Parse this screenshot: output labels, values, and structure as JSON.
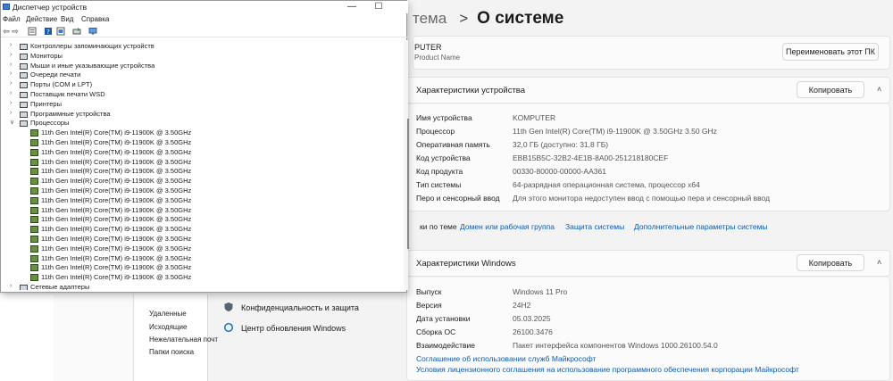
{
  "settings": {
    "breadcrumb_prev": "тема",
    "breadcrumb_sep": ">",
    "breadcrumb_current": "О системе",
    "pc_name": "PUTER",
    "pc_sub": "Product Name",
    "rename_button": "Переименовать этот ПК",
    "device_specs_title": "Характеристики устройства",
    "copy_button": "Копировать",
    "device_specs": [
      {
        "label": "Имя устройства",
        "value": "KOMPUTER"
      },
      {
        "label": "Процессор",
        "value": "11th Gen Intel(R) Core(TM) i9-11900K @ 3.50GHz   3.50 GHz"
      },
      {
        "label": "Оперативная память",
        "value": "32,0 ГБ (доступно: 31,8 ГБ)"
      },
      {
        "label": "Код устройства",
        "value": "EBB15B5C-32B2-4E1B-8A00-251218180CEF"
      },
      {
        "label": "Код продукта",
        "value": "00330-80000-00000-AA361"
      },
      {
        "label": "Тип системы",
        "value": "64-разрядная операционная система, процессор x64"
      },
      {
        "label": "Перо и сенсорный ввод",
        "value": "Для этого монитора недоступен ввод с помощью пера и сенсорный ввод"
      }
    ],
    "related_label": "ки по теме",
    "related_links": [
      "Домен или рабочая группа",
      "Защита системы",
      "Дополнительные параметры системы"
    ],
    "windows_specs_title": "Характеристики Windows",
    "windows_specs": [
      {
        "label": "Выпуск",
        "value": "Windows 11 Pro"
      },
      {
        "label": "Версия",
        "value": "24H2"
      },
      {
        "label": "Дата установки",
        "value": "05.03.2025"
      },
      {
        "label": "Сборка ОС",
        "value": "26100.3476"
      },
      {
        "label": "Взаимодействие",
        "value": "Пакет интерфейса компонентов Windows 1000.26100.54.0"
      }
    ],
    "windows_links": [
      "Соглашение об использовании служб Майкрософт",
      "Условия лицензионного соглашения на использование программного обеспечения корпорации Майкрософт"
    ],
    "nav": [
      "Конфиденциальность и защита",
      "Центр обновления Windows"
    ]
  },
  "explorer": {
    "items": [
      "Удаленные",
      "Исходящие",
      "Нежелательная почт",
      "Папки поиска"
    ]
  },
  "devmgr": {
    "title": "Диспетчер устройств",
    "controls": {
      "minimize": "—",
      "maximize": "☐"
    },
    "menu": [
      "Файл",
      "Действие",
      "Вид",
      "Справка"
    ],
    "categories": [
      "Контроллеры запоминающих устройств",
      "Мониторы",
      "Мыши и иные указывающие устройства",
      "Очереди печати",
      "Порты (COM и LPT)",
      "Поставщик печати WSD",
      "Принтеры",
      "Программные устройства",
      "Процессоры"
    ],
    "processors": [
      "11th Gen Intel(R) Core(TM) i9-11900K @ 3.50GHz",
      "11th Gen Intel(R) Core(TM) i9-11900K @ 3.50GHz",
      "11th Gen Intel(R) Core(TM) i9-11900K @ 3.50GHz",
      "11th Gen Intel(R) Core(TM) i9-11900K @ 3.50GHz",
      "11th Gen Intel(R) Core(TM) i9-11900K @ 3.50GHz",
      "11th Gen Intel(R) Core(TM) i9-11900K @ 3.50GHz",
      "11th Gen Intel(R) Core(TM) i9-11900K @ 3.50GHz",
      "11th Gen Intel(R) Core(TM) i9-11900K @ 3.50GHz",
      "11th Gen Intel(R) Core(TM) i9-11900K @ 3.50GHz",
      "11th Gen Intel(R) Core(TM) i9-11900K @ 3.50GHz",
      "11th Gen Intel(R) Core(TM) i9-11900K @ 3.50GHz",
      "11th Gen Intel(R) Core(TM) i9-11900K @ 3.50GHz",
      "11th Gen Intel(R) Core(TM) i9-11900K @ 3.50GHz",
      "11th Gen Intel(R) Core(TM) i9-11900K @ 3.50GHz",
      "11th Gen Intel(R) Core(TM) i9-11900K @ 3.50GHz",
      "11th Gen Intel(R) Core(TM) i9-11900K @ 3.50GHz"
    ],
    "next_category": "Сетевые адаптеры"
  }
}
